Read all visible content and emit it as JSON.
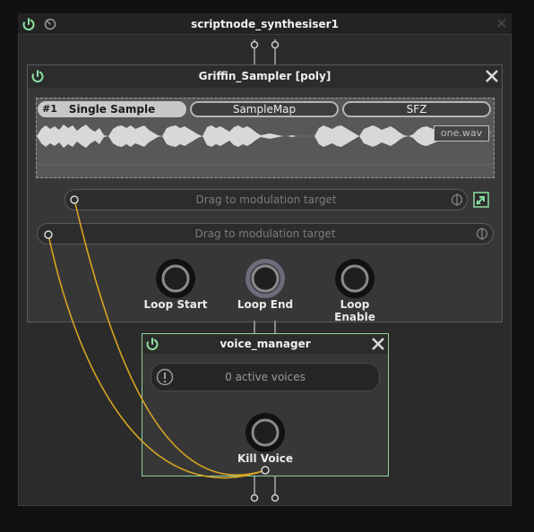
{
  "colors": {
    "power": "#8be0a0",
    "cable": "#d7a520",
    "accent_border": "#8bd19b"
  },
  "outer_node": {
    "title": "scriptnode_synthesiser1",
    "power_icon": "power-icon",
    "clock_icon": "clock-icon",
    "close_icon": "close-icon"
  },
  "sampler_node": {
    "title": "Griffin_Sampler [poly]",
    "tabs": [
      {
        "number": "#1",
        "label": "Single Sample"
      },
      {
        "label": "SampleMap"
      },
      {
        "label": "SFZ"
      }
    ],
    "file_name": "one.wav",
    "mod_slots": [
      {
        "label": "Drag to modulation target"
      },
      {
        "label": "Drag to modulation target"
      }
    ],
    "knobs": [
      {
        "label": "Loop Start",
        "value": 0.0
      },
      {
        "label": "Loop End",
        "value": 0.0
      },
      {
        "label": "Loop Enable",
        "value": 0.0
      }
    ]
  },
  "voice_manager": {
    "title": "voice_manager",
    "active_voices": "0 active voices",
    "knob": {
      "label": "Kill Voice",
      "value": 0.0
    }
  }
}
